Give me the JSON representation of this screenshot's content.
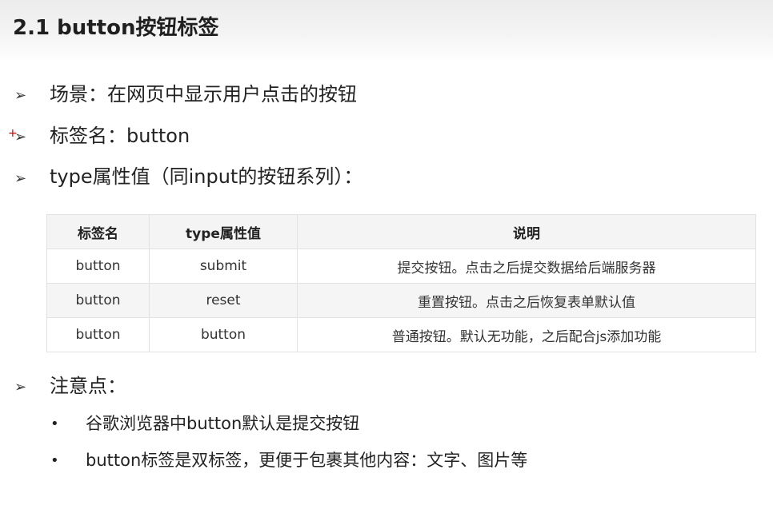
{
  "title": "2.1 button按钮标签",
  "bullets": [
    {
      "marker": "➢",
      "text": "场景：在网页中显示用户点击的按钮"
    },
    {
      "marker": "➢",
      "text": "标签名：button"
    },
    {
      "marker": "➢",
      "text": "type属性值（同input的按钮系列）："
    }
  ],
  "cursor_mark": "+",
  "table": {
    "headers": [
      "标签名",
      "type属性值",
      "说明"
    ],
    "rows": [
      [
        "button",
        "submit",
        "提交按钮。点击之后提交数据给后端服务器"
      ],
      [
        "button",
        "reset",
        "重置按钮。点击之后恢复表单默认值"
      ],
      [
        "button",
        "button",
        "普通按钮。默认无功能，之后配合js添加功能"
      ]
    ]
  },
  "notes": {
    "marker": "➢",
    "heading": "注意点：",
    "items": [
      {
        "marker": "•",
        "text": "谷歌浏览器中button默认是提交按钮"
      },
      {
        "marker": "•",
        "text": "button标签是双标签，更便于包裹其他内容：文字、图片等"
      }
    ]
  }
}
